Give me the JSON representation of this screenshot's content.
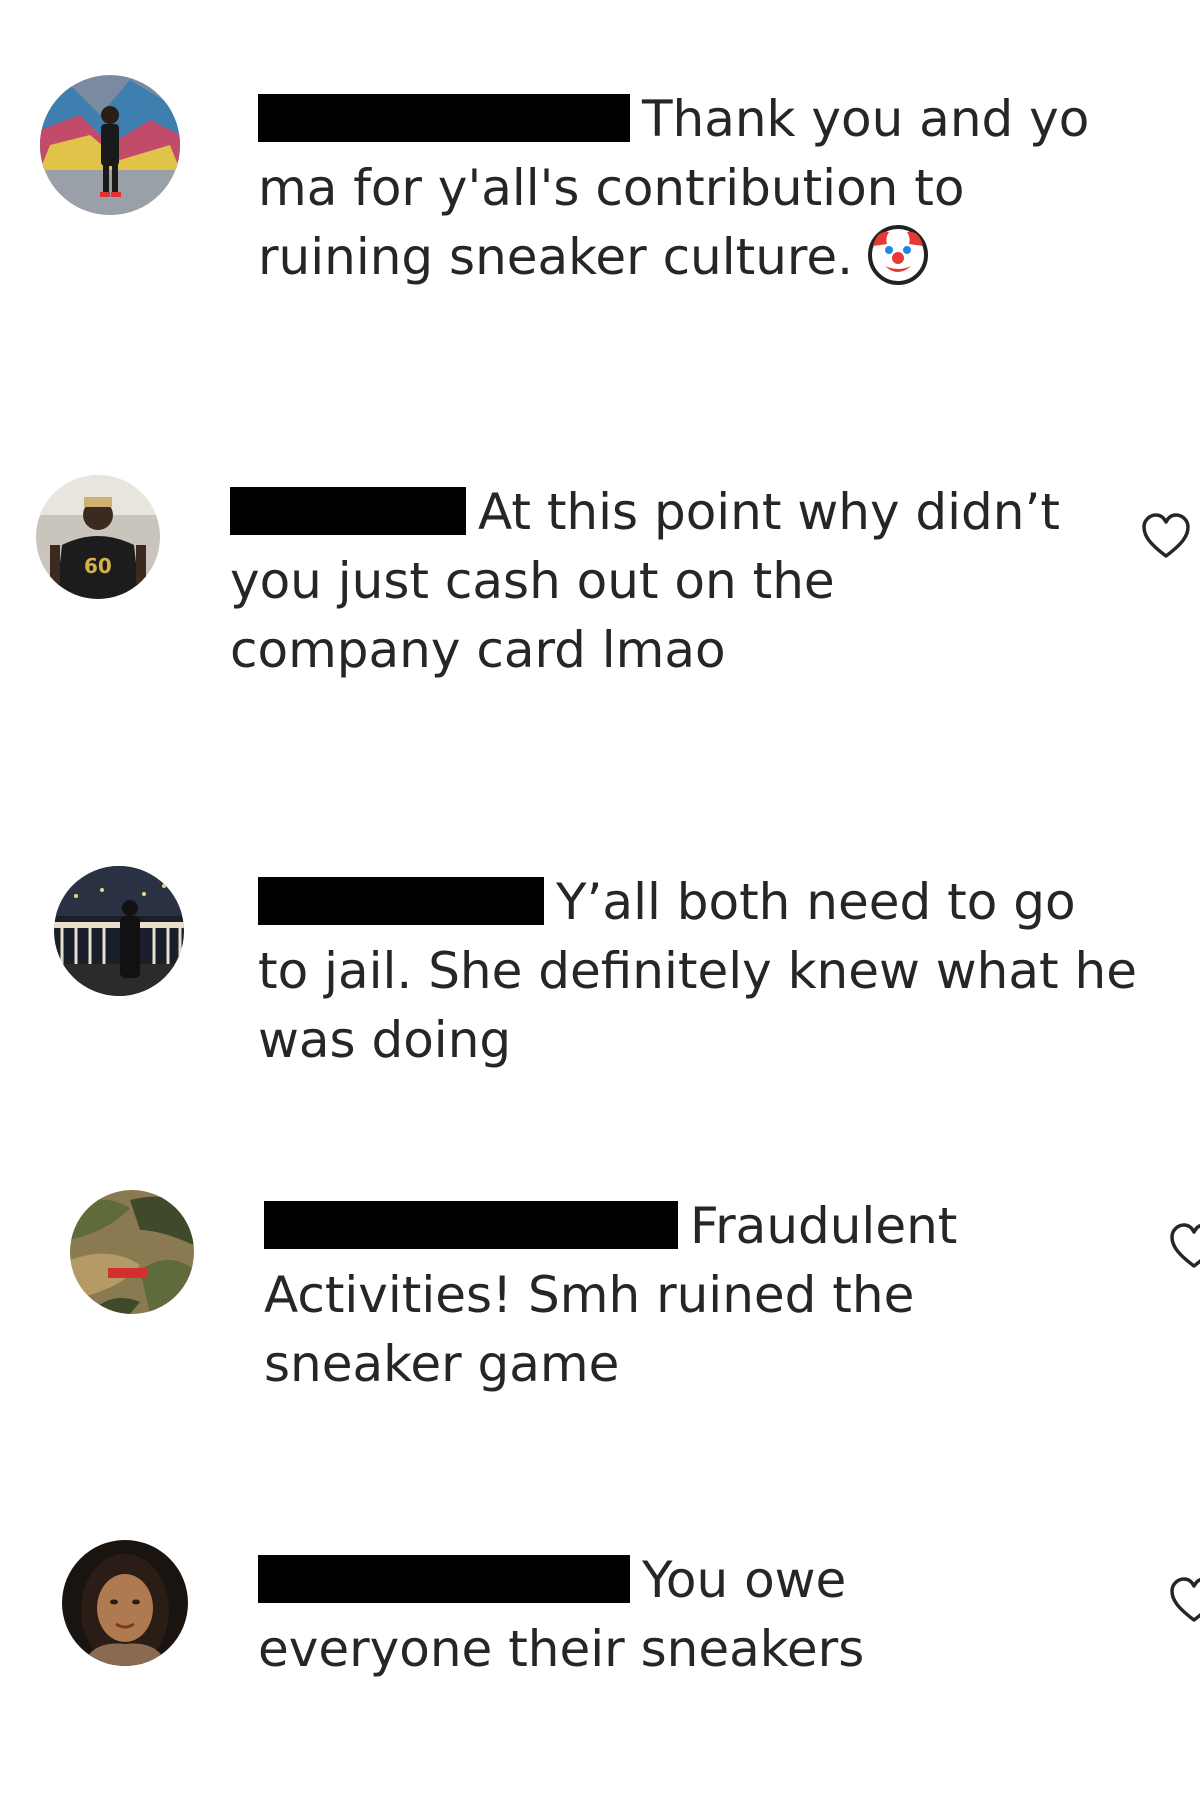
{
  "comments": [
    {
      "text": "Thank you and yo ma for y'all's contribution to ruining sneaker culture.",
      "emoji_icon": "clown-face-icon",
      "has_like_button": false
    },
    {
      "text": "At this point why didn’t you just cash out on the company card lmao",
      "has_like_button": true
    },
    {
      "text": "Y’all both need to go to jail. She definitely knew what he was doing",
      "has_like_button": false
    },
    {
      "text": "Fraudulent Activities! Smh ruined the sneaker game",
      "has_like_button": true
    },
    {
      "text": "You owe everyone their sneakers",
      "has_like_button": true
    }
  ],
  "icons": {
    "like": "heart-outline-icon",
    "redaction": "redacted-username-bar"
  },
  "colors": {
    "text": "#262626",
    "redaction": "#000000",
    "heart_stroke": "#262626",
    "background": "#ffffff"
  }
}
